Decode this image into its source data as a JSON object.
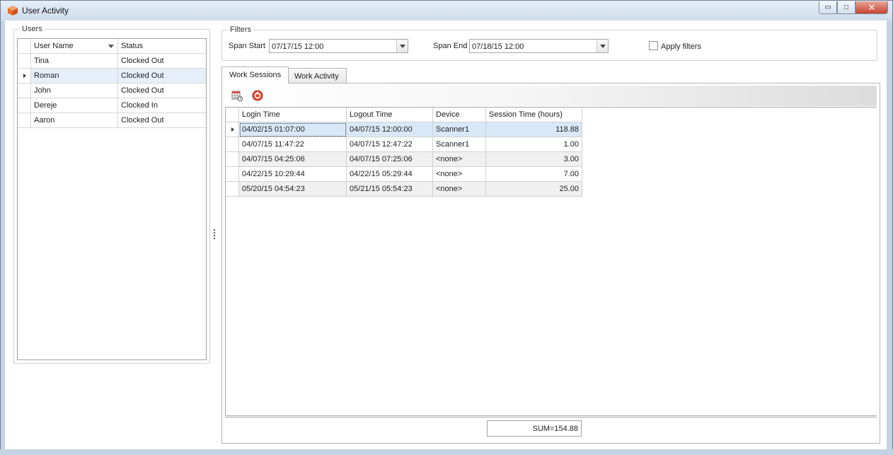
{
  "window": {
    "title": "User Activity",
    "controls": {
      "minimize": "▭",
      "maximize": "□",
      "close": "✕"
    }
  },
  "users_panel": {
    "legend": "Users",
    "columns": [
      "User Name",
      "Status"
    ],
    "rows": [
      {
        "name": "Tina",
        "status": "Clocked Out"
      },
      {
        "name": "Roman",
        "status": "Clocked Out"
      },
      {
        "name": "John",
        "status": "Clocked Out"
      },
      {
        "name": "Dereje",
        "status": "Clocked In"
      },
      {
        "name": "Aaron",
        "status": "Clocked Out"
      }
    ],
    "selected_index": 1
  },
  "filters": {
    "legend": "Filters",
    "span_start_label": "Span Start",
    "span_start_value": "07/17/15 12:00",
    "span_end_label": "Span End",
    "span_end_value": "07/18/15 12:00",
    "apply_filters_label": "Apply filters",
    "apply_filters_checked": false
  },
  "tabs": [
    {
      "label": "Work Sessions",
      "active": true
    },
    {
      "label": "Work Activity",
      "active": false
    }
  ],
  "toolbar": {
    "icons": [
      "calendar-grid-icon",
      "reset-icon"
    ]
  },
  "sessions": {
    "columns": [
      "Login Time",
      "Logout Time",
      "Device",
      "Session Time (hours)"
    ],
    "rows": [
      {
        "login": "04/02/15 01:07:00",
        "logout": "04/07/15 12:00:00",
        "device": "Scanner1",
        "hours": "118.88"
      },
      {
        "login": "04/07/15 11:47:22",
        "logout": "04/07/15 12:47:22",
        "device": "Scanner1",
        "hours": "1.00"
      },
      {
        "login": "04/07/15 04:25:06",
        "logout": "04/07/15 07:25:06",
        "device": "<none>",
        "hours": "3.00"
      },
      {
        "login": "04/22/15 10:29:44",
        "logout": "04/22/15 05:29:44",
        "device": "<none>",
        "hours": "7.00"
      },
      {
        "login": "05/20/15 04:54:23",
        "logout": "05/21/15 05:54:23",
        "device": "<none>",
        "hours": "25.00"
      }
    ],
    "selected_index": 0,
    "sum_label": "SUM=154.88"
  },
  "colors": {
    "selection": "#d9e8f7",
    "frame": "#c4d3e3",
    "close_button": "#c7432f",
    "app_icon": "#e8702a"
  }
}
